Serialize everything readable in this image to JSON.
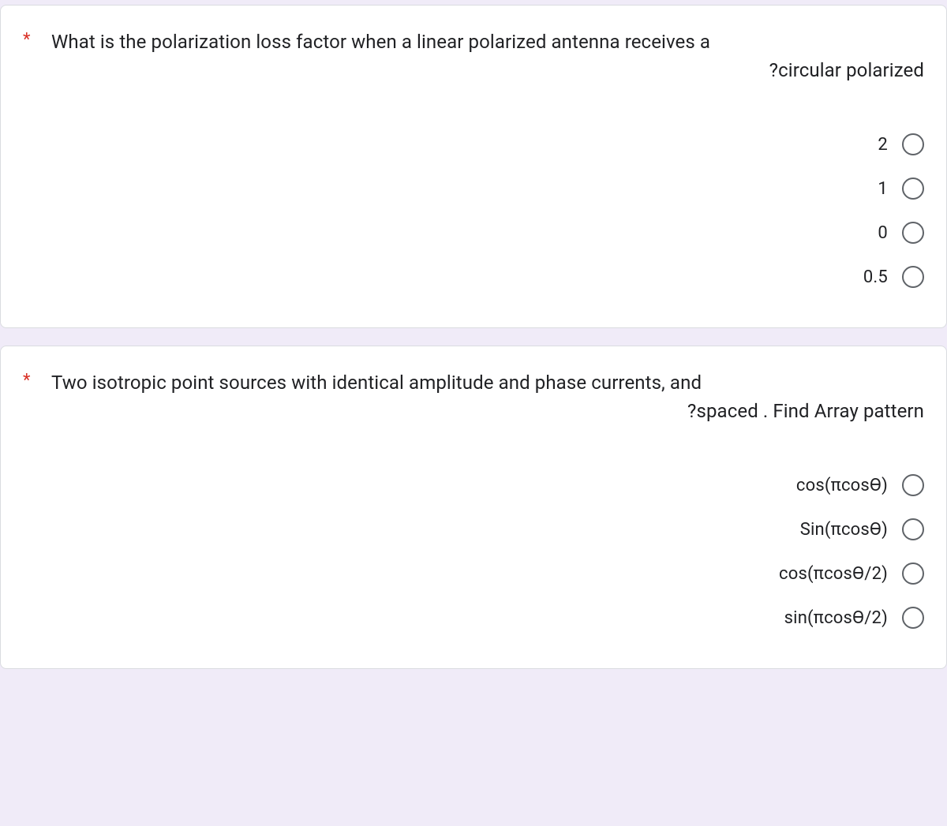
{
  "questions": [
    {
      "required_mark": "*",
      "line1": "What is the polarization loss factor when a linear polarized antenna receives a",
      "line2": "?circular polarized",
      "options": [
        "2",
        "1",
        "0",
        "0.5"
      ]
    },
    {
      "required_mark": "*",
      "line1": "Two isotropic point sources with identical amplitude and phase currents, and",
      "line2": "?spaced   . Find Array pattern",
      "options": [
        "cos(πcosӨ)",
        "Sin(πcosӨ)",
        "cos(πcosӨ/2)",
        "sin(πcosӨ/2)"
      ]
    }
  ]
}
